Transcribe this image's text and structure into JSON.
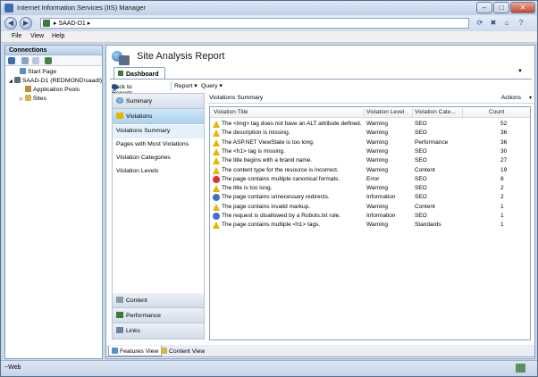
{
  "window": {
    "title": "Internet Information Services (IIS) Manager",
    "controls": {
      "minimize": "–",
      "maximize": "□",
      "close": "✕"
    }
  },
  "address": {
    "crumb": "SAAD-D1",
    "crumb_separator": "▸",
    "icons": [
      "back-icon",
      "forward-icon",
      "refresh-icon",
      "stop-icon",
      "home-icon",
      "help-icon"
    ]
  },
  "menu": {
    "file": "File",
    "view": "View",
    "help": "Help"
  },
  "connections": {
    "title": "Connections",
    "tree": [
      {
        "label": "Start Page",
        "level": 0
      },
      {
        "label": "SAAD-D1 (REDMOND\\saadl)",
        "level": 0
      },
      {
        "label": "Application Pools",
        "level": 1
      },
      {
        "label": "Sites",
        "level": 1
      }
    ]
  },
  "report": {
    "title": "Site Analysis Report",
    "tab": "Dashboard",
    "tab_caret": "▼",
    "back": "Back to Reports",
    "report_menu": "Report ▾",
    "query_menu": "Query ▾"
  },
  "nav": {
    "summary": "Summary",
    "violations": "Violations",
    "sub_items": [
      "Violations Summary",
      "Pages with Most Violations",
      "Violation Categories",
      "Violation Levels"
    ],
    "content": "Content",
    "performance": "Performance",
    "links": "Links"
  },
  "violations_summary": {
    "title": "Violations Summary",
    "actions": "Actions",
    "actions_caret": "▾",
    "columns": [
      "Violation Title",
      "Violation Level",
      "Violation Cate...",
      "Count"
    ],
    "rows": [
      {
        "title": "The <img> tag does not have an ALT attribute defined.",
        "level": "Warning",
        "category": "SEO",
        "count": "52",
        "icon": "warning"
      },
      {
        "title": "The description is missing.",
        "level": "Warning",
        "category": "SEO",
        "count": "36",
        "icon": "warning"
      },
      {
        "title": "The ASP.NET ViewState is too long.",
        "level": "Warning",
        "category": "Performance",
        "count": "36",
        "icon": "warning"
      },
      {
        "title": "The <h1> tag is missing.",
        "level": "Warning",
        "category": "SEO",
        "count": "30",
        "icon": "warning"
      },
      {
        "title": "The title begins with a brand name.",
        "level": "Warning",
        "category": "SEO",
        "count": "27",
        "icon": "warning"
      },
      {
        "title": "The content type for the resource is incorrect.",
        "level": "Warning",
        "category": "Content",
        "count": "19",
        "icon": "warning"
      },
      {
        "title": "The page contains multiple canonical formats.",
        "level": "Error",
        "category": "SEO",
        "count": "8",
        "icon": "error"
      },
      {
        "title": "The title is too long.",
        "level": "Warning",
        "category": "SEO",
        "count": "2",
        "icon": "warning"
      },
      {
        "title": "The page contains unnecessary redirects.",
        "level": "Information",
        "category": "SEO",
        "count": "2",
        "icon": "information"
      },
      {
        "title": "The page contains invalid markup.",
        "level": "Warning",
        "category": "Content",
        "count": "1",
        "icon": "warning"
      },
      {
        "title": "The request is disallowed by a Robots.txt rule.",
        "level": "Information",
        "category": "SEO",
        "count": "1",
        "icon": "information"
      },
      {
        "title": "The page contains multiple <h1> tags.",
        "level": "Warning",
        "category": "Standards",
        "count": "1",
        "icon": "warning"
      }
    ]
  },
  "bottom_tabs": {
    "features": "Features View",
    "content": "Content View"
  },
  "status": {
    "text": "Web"
  },
  "colors": {
    "warning": "#e8b500",
    "error": "#d33333",
    "information": "#3c72c7",
    "selection": "#a9d3f1"
  }
}
